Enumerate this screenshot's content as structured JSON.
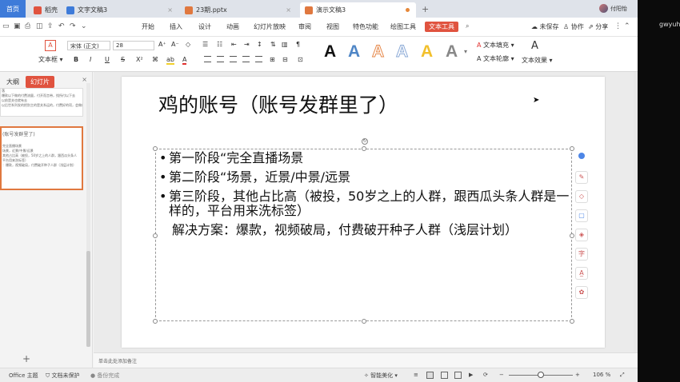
{
  "tabs": {
    "home": "首页",
    "items": [
      {
        "label": "稻壳",
        "color": "#e0533f"
      },
      {
        "label": "文字文稿3",
        "color": "#3e7bd9"
      },
      {
        "label": "23期.pptx",
        "color": "#e0783f"
      },
      {
        "label": "演示文稿3",
        "color": "#e0783f"
      }
    ],
    "add": "+",
    "account": "付阳怡"
  },
  "menu": {
    "items": [
      "开始",
      "插入",
      "设计",
      "动画",
      "幻灯片放映",
      "审阅",
      "视图",
      "特色功能",
      "绘图工具",
      "文本工具"
    ],
    "active": "文本工具",
    "right": [
      "未保存",
      "协作",
      "分享"
    ]
  },
  "ribbon": {
    "textbox_label": "文本框",
    "font_name": "宋体 (正文)",
    "font_size": "28",
    "bold": "B",
    "italic": "I",
    "underline": "U",
    "strike": "S",
    "superscript": "X²",
    "style_letter": "A",
    "text_fill": "文本填充",
    "text_outline": "文本轮廓",
    "text_effect": "文本效果",
    "style_colors": [
      "#111111",
      "#4f86c6",
      "#e6884a",
      "#8aa9d6",
      "#f2c02c",
      "#888888"
    ]
  },
  "left_panel": {
    "tab_outline": "大纲",
    "tab_slides": "幻灯片",
    "thumb1_lines": [
      "落",
      "爆款以下做的付费流量，付开而言带，找所付以下去",
      "以前是关也就有去",
      "以后世系列发的把别主的是关系运的，付费好的项，会做的"
    ],
    "thumb2_lines": [
      "(账号发群里了)",
      "完全直播场景",
      "场景，近景/中景/远景",
      "其他占比高（被投，50岁之上的人群，跟西瓜头条人",
      "平台用来洗标签）",
      "：爆款，视频破局，付费破开种子人群（浅层计划）"
    ],
    "add": "+"
  },
  "slide": {
    "title": "鸡的账号（账号发群里了）",
    "bullets": [
      "第一阶段“完全直播场景",
      "第二阶段“场景，近景/中景/远景",
      "第三阶段，其他占比高（被投，50岁之上的人群，跟西瓜头条人群是一样的，平台用来洗标签）"
    ],
    "solution": "解决方案：爆款，视频破局，付费破开种子人群（浅层计划）"
  },
  "notes_placeholder": "单击此处添加备注",
  "status": {
    "theme": "Office 主题",
    "protect": "文档未保护",
    "backup": "备份完成",
    "beautify": "智能美化",
    "zoom": "106 %"
  },
  "right_user": "gwyuhu"
}
